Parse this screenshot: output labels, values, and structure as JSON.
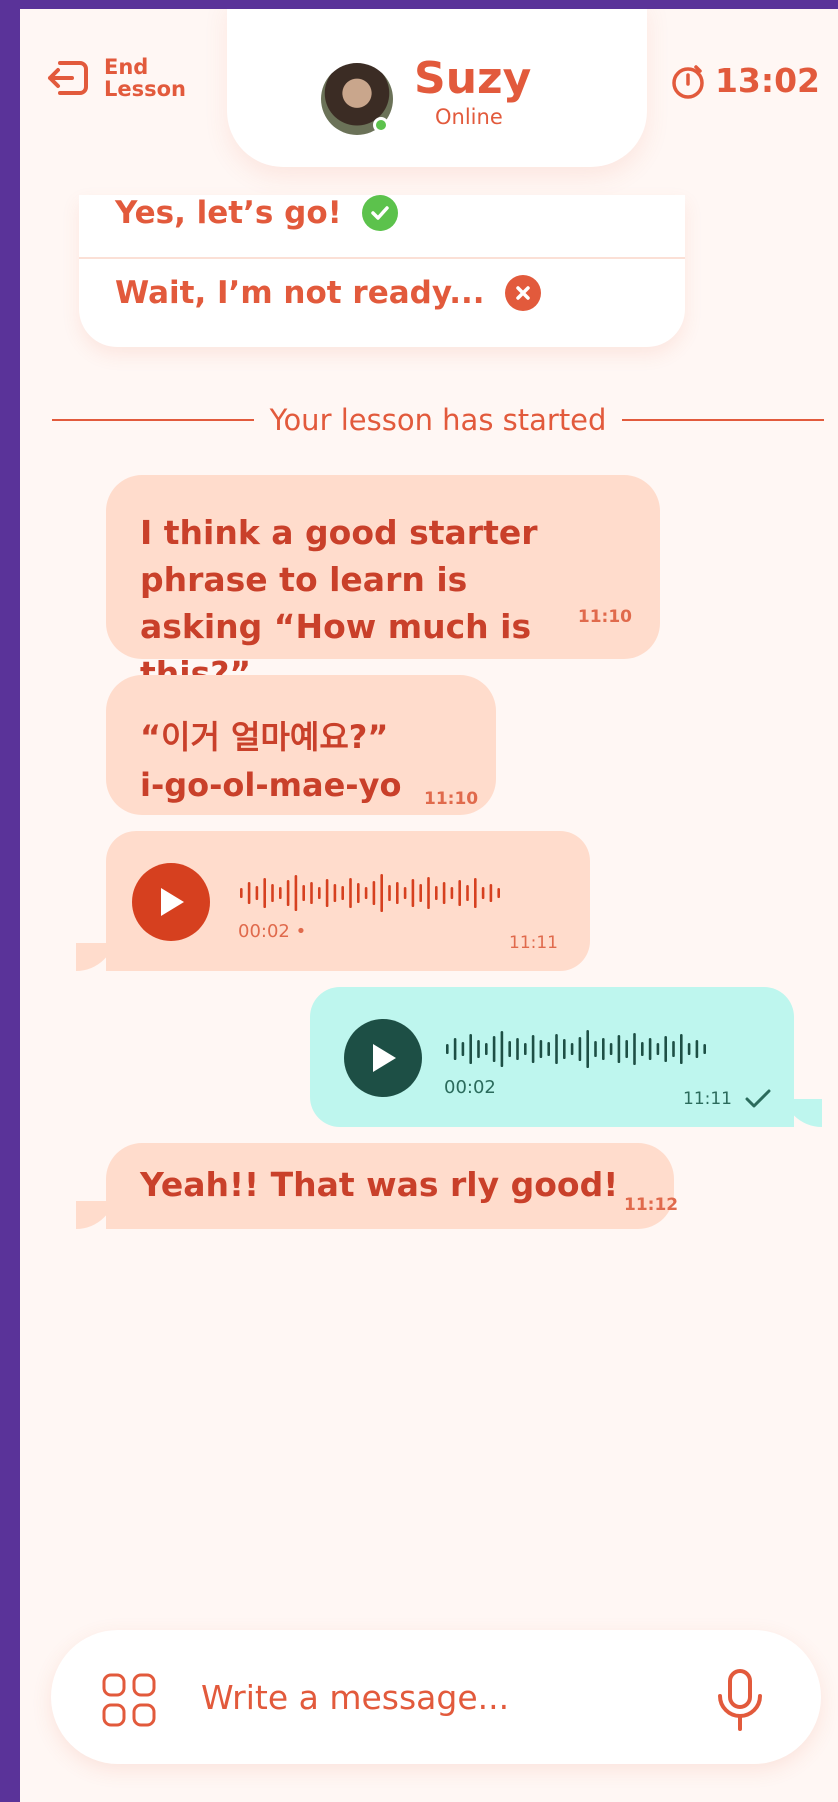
{
  "header": {
    "end_lesson_label": "End\nLesson",
    "contact_name": "Suzy",
    "contact_status": "Online",
    "timer": "13:02"
  },
  "options": {
    "yes_label": "Yes, let’s go!",
    "no_label": "Wait, I’m not ready..."
  },
  "divider_text": "Your lesson has started",
  "messages": [
    {
      "text": "I think a good starter phrase to learn is asking “How much is this?”",
      "time": "11:10"
    },
    {
      "line1": "“이거 얼마예요?”",
      "line2": "i-go-ol-mae-yo",
      "time": "11:10"
    },
    {
      "type": "voice",
      "duration": "00:02 •",
      "time": "11:11"
    },
    {
      "type": "voice",
      "duration": "00:02",
      "time": "11:11",
      "status": "read"
    },
    {
      "text": "Yeah!! That was rly good!",
      "time": "11:12"
    }
  ],
  "composer": {
    "placeholder": "Write a message..."
  },
  "colors": {
    "accent": "#e25a3c",
    "incoming_bubble": "#ffdccc",
    "outgoing_bubble": "#bef6ee",
    "background": "#fff7f4",
    "frame": "#5a3399"
  }
}
